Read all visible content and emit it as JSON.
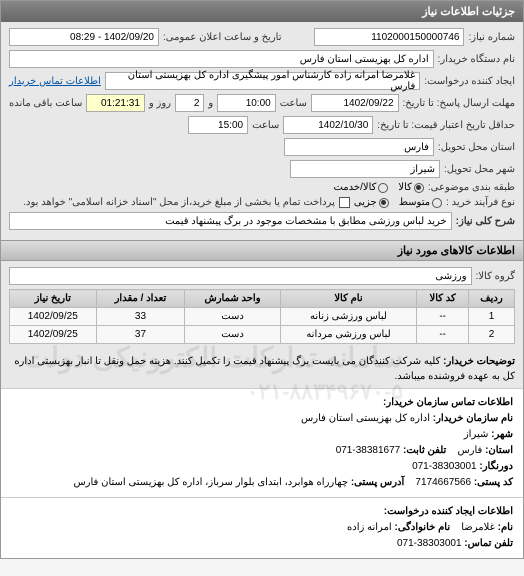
{
  "panel_title": "جزئیات اطلاعات نیاز",
  "row1": {
    "number_label": "شماره نیاز:",
    "number_value": "1102000150000746",
    "announce_label": "تاریخ و ساعت اعلان عمومی:",
    "announce_value": "1402/09/20 - 08:29"
  },
  "row2": {
    "buyer_label": "نام دستگاه خریدار:",
    "buyer_value": "اداره کل بهزیستی استان فارس"
  },
  "row3": {
    "creator_label": "ایجاد کننده درخواست:",
    "creator_value": "غلامرضا امرانه زاده کارشناس امور پیشگیری اداره کل بهزیستی استان فارس",
    "buyer_contact_link": "اطلاعات تماس خریدار"
  },
  "row4": {
    "reply_deadline_label": "مهلت ارسال پاسخ: تا تاریخ:",
    "reply_date": "1402/09/22",
    "reply_time_label": "ساعت",
    "reply_time": "10:00",
    "days_label": "و",
    "days_value": "2",
    "days_suffix": "روز و",
    "countdown": "01:21:31",
    "countdown_suffix": "ساعت باقی مانده"
  },
  "row5": {
    "price_deadline_label": "حداقل تاریخ اعتبار قیمت: تا تاریخ:",
    "price_date": "1402/10/30",
    "price_time_label": "ساعت",
    "price_time": "15:00"
  },
  "row6": {
    "province_label": "استان محل تحویل:",
    "province_value": "فارس"
  },
  "row7": {
    "city_label": "شهر محل تحویل:",
    "city_value": "شیراز"
  },
  "row8": {
    "category_label": "طبقه بندی موضوعی:",
    "r_goods": "کالا",
    "r_service": "کالا/خدمت"
  },
  "row9": {
    "buy_type_label": "نوع فرآیند خرید :",
    "r_small": "متوسط",
    "r_partial": "جزیی",
    "note": "پرداخت تمام یا بخشی از مبلغ خرید،از محل \"اسناد خزانه اسلامی\" خواهد بود."
  },
  "row10": {
    "summary_label": "شرح کلی نیاز:",
    "summary_value": "خرید لباس ورزشی مطابق با مشخصات موجود در برگ پیشنهاد قیمت"
  },
  "goods": {
    "section_title": "اطلاعات کالاهای مورد نیاز",
    "group_label": "گروه کالا:",
    "group_value": "ورزشی",
    "headers": {
      "row": "ردیف",
      "iran_code": "کد کالا",
      "name": "نام کالا",
      "unit": "واحد شمارش",
      "qty": "تعداد / مقدار",
      "need_date": "تاریخ نیاز"
    },
    "rows": [
      {
        "row": "1",
        "iran_code": "--",
        "name": "لباس ورزشی زنانه",
        "unit": "دست",
        "qty": "33",
        "need_date": "1402/09/25"
      },
      {
        "row": "2",
        "iran_code": "--",
        "name": "لباس ورزشی مردانه",
        "unit": "دست",
        "qty": "37",
        "need_date": "1402/09/25"
      }
    ]
  },
  "buyer_notes": {
    "label": "توضیحات خریدار:",
    "text": "کلیه شرکت کنندگان می بایست برگ پیشنهاد قیمت را تکمیل کنند. هزینه حمل ونقل تا انبار بهزیستی اداره کل به عهده فروشنده میباشد."
  },
  "watermark": "سامانه تدارکات الکترونیکی دولت",
  "watermark_phone": "۰۲۱-۸۸۳۴۹۶۷۰-۵",
  "contact_buyer": {
    "title": "اطلاعات تماس سازمان خریدار:",
    "org_label": "نام سازمان خریدار:",
    "org": "اداره کل بهزیستی استان فارس",
    "city_label": "شهر:",
    "city": "شیراز",
    "province_label": "استان:",
    "province": "فارس",
    "phone_label": "تلفن ثابت:",
    "phone": "38381677-071",
    "fax_label": "دورنگار:",
    "fax": "38303001-071",
    "postal_label": "کد پستی:",
    "postal": "7174667566",
    "address_label": "آدرس پستی:",
    "address": "چهارراه هوابرد، ابتدای بلوار سرباز، اداره کل بهزیستی استان فارس"
  },
  "contact_creator": {
    "title": "اطلاعات ایجاد کننده درخواست:",
    "first_label": "نام:",
    "first": "غلامرضا",
    "last_label": "نام خانوادگی:",
    "last": "امرانه زاده",
    "phone_label": "تلفن تماس:",
    "phone": "38303001-071"
  }
}
